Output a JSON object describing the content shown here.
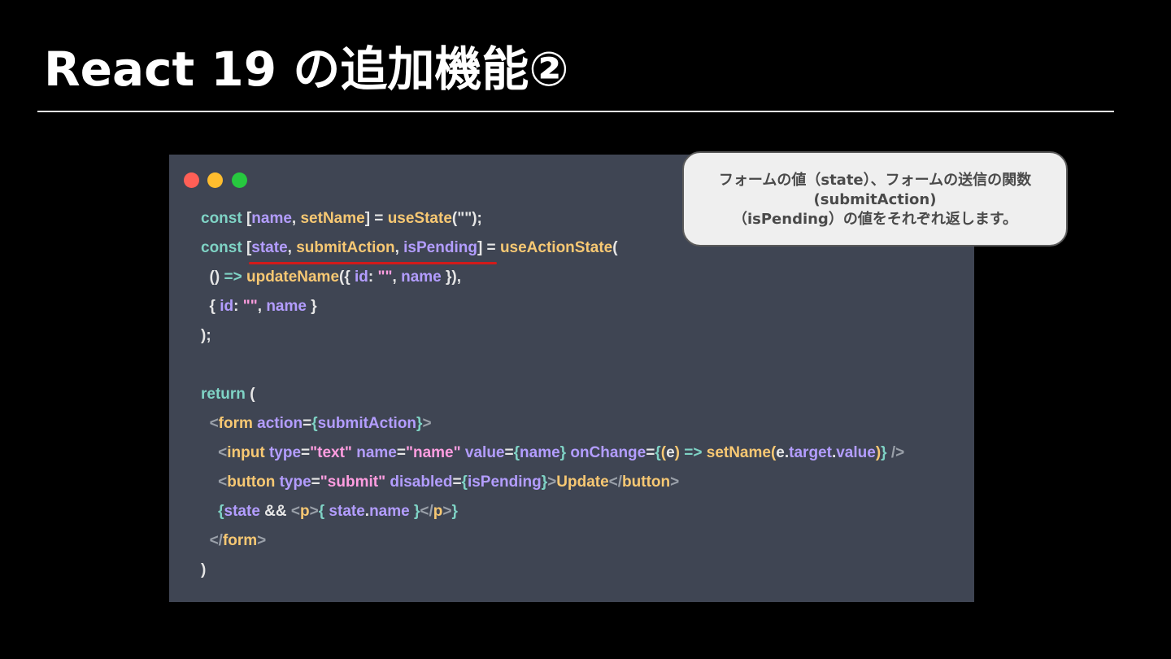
{
  "slide": {
    "title": "React 19 の追加機能②"
  },
  "callout": {
    "lines": [
      "フォームの値（state）、フォームの送信の関数",
      "(submitAction)",
      "（isPending）の値をそれぞれ返します。"
    ]
  },
  "colors": {
    "background": "#000000",
    "code_background": "#3f4553",
    "keyword": "#7fd3c5",
    "variable": "#b39dff",
    "function": "#f7c873",
    "string": "#ff9de0",
    "underline": "#d21a1a",
    "dot_red": "#ff5f56",
    "dot_yellow": "#ffbd2e",
    "dot_green": "#27c93f"
  },
  "code": {
    "lines": [
      [
        {
          "t": "const ",
          "c": "kw"
        },
        {
          "t": "[",
          "c": "pun"
        },
        {
          "t": "name",
          "c": "var"
        },
        {
          "t": ", ",
          "c": "pun"
        },
        {
          "t": "setName",
          "c": "fn"
        },
        {
          "t": "] = ",
          "c": "pun"
        },
        {
          "t": "useState",
          "c": "fn"
        },
        {
          "t": "(\"\");",
          "c": "pun"
        }
      ],
      [
        {
          "t": "const ",
          "c": "kw"
        },
        {
          "t": "[",
          "c": "pun"
        },
        {
          "t": "state",
          "c": "var"
        },
        {
          "t": ", ",
          "c": "pun"
        },
        {
          "t": "submitAction",
          "c": "fn"
        },
        {
          "t": ", ",
          "c": "pun"
        },
        {
          "t": "isPending",
          "c": "var"
        },
        {
          "t": "] = ",
          "c": "pun"
        },
        {
          "t": "useActionState",
          "c": "fn"
        },
        {
          "t": "(",
          "c": "pun"
        }
      ],
      [
        {
          "t": "  () ",
          "c": "pun"
        },
        {
          "t": "=> ",
          "c": "kw"
        },
        {
          "t": "updateName",
          "c": "fn"
        },
        {
          "t": "({ ",
          "c": "pun"
        },
        {
          "t": "id",
          "c": "var"
        },
        {
          "t": ": ",
          "c": "pun"
        },
        {
          "t": "\"\"",
          "c": "str"
        },
        {
          "t": ", ",
          "c": "pun"
        },
        {
          "t": "name",
          "c": "var"
        },
        {
          "t": " }),",
          "c": "pun"
        }
      ],
      [
        {
          "t": "  { ",
          "c": "pun"
        },
        {
          "t": "id",
          "c": "var"
        },
        {
          "t": ": ",
          "c": "pun"
        },
        {
          "t": "\"\"",
          "c": "str"
        },
        {
          "t": ", ",
          "c": "pun"
        },
        {
          "t": "name",
          "c": "var"
        },
        {
          "t": " }",
          "c": "pun"
        }
      ],
      [
        {
          "t": ");",
          "c": "pun"
        }
      ],
      [],
      [
        {
          "t": "return ",
          "c": "kw"
        },
        {
          "t": "(",
          "c": "pun"
        }
      ],
      [
        {
          "t": "  ",
          "c": "pun"
        },
        {
          "t": "<",
          "c": "dim"
        },
        {
          "t": "form ",
          "c": "fn"
        },
        {
          "t": "action",
          "c": "var"
        },
        {
          "t": "=",
          "c": "pun"
        },
        {
          "t": "{",
          "c": "brace"
        },
        {
          "t": "submitAction",
          "c": "var"
        },
        {
          "t": "}",
          "c": "brace"
        },
        {
          "t": ">",
          "c": "dim"
        }
      ],
      [
        {
          "t": "    ",
          "c": "pun"
        },
        {
          "t": "<",
          "c": "dim"
        },
        {
          "t": "input ",
          "c": "fn"
        },
        {
          "t": "type",
          "c": "var"
        },
        {
          "t": "=",
          "c": "pun"
        },
        {
          "t": "\"text\" ",
          "c": "str"
        },
        {
          "t": "name",
          "c": "var"
        },
        {
          "t": "=",
          "c": "pun"
        },
        {
          "t": "\"name\" ",
          "c": "str"
        },
        {
          "t": "value",
          "c": "var"
        },
        {
          "t": "=",
          "c": "pun"
        },
        {
          "t": "{",
          "c": "brace"
        },
        {
          "t": "name",
          "c": "var"
        },
        {
          "t": "} ",
          "c": "brace"
        },
        {
          "t": "onChange",
          "c": "var"
        },
        {
          "t": "=",
          "c": "pun"
        },
        {
          "t": "{",
          "c": "brace"
        },
        {
          "t": "(",
          "c": "fn"
        },
        {
          "t": "e",
          "c": "plain"
        },
        {
          "t": ") ",
          "c": "fn"
        },
        {
          "t": "=> ",
          "c": "kw"
        },
        {
          "t": "setName",
          "c": "fn"
        },
        {
          "t": "(",
          "c": "fn"
        },
        {
          "t": "e",
          "c": "plain"
        },
        {
          "t": ".",
          "c": "pun"
        },
        {
          "t": "target",
          "c": "var"
        },
        {
          "t": ".",
          "c": "pun"
        },
        {
          "t": "value",
          "c": "var"
        },
        {
          "t": ")",
          "c": "fn"
        },
        {
          "t": "} ",
          "c": "brace"
        },
        {
          "t": "/>",
          "c": "dim"
        }
      ],
      [
        {
          "t": "    ",
          "c": "pun"
        },
        {
          "t": "<",
          "c": "dim"
        },
        {
          "t": "button ",
          "c": "fn"
        },
        {
          "t": "type",
          "c": "var"
        },
        {
          "t": "=",
          "c": "pun"
        },
        {
          "t": "\"submit\" ",
          "c": "str"
        },
        {
          "t": "disabled",
          "c": "var"
        },
        {
          "t": "=",
          "c": "pun"
        },
        {
          "t": "{",
          "c": "brace"
        },
        {
          "t": "isPending",
          "c": "var"
        },
        {
          "t": "}",
          "c": "brace"
        },
        {
          "t": ">",
          "c": "dim"
        },
        {
          "t": "Update",
          "c": "fn"
        },
        {
          "t": "</",
          "c": "dim"
        },
        {
          "t": "button",
          "c": "fn"
        },
        {
          "t": ">",
          "c": "dim"
        }
      ],
      [
        {
          "t": "    ",
          "c": "pun"
        },
        {
          "t": "{",
          "c": "brace"
        },
        {
          "t": "state ",
          "c": "var"
        },
        {
          "t": "&& ",
          "c": "pun"
        },
        {
          "t": "<",
          "c": "dim"
        },
        {
          "t": "p",
          "c": "fn"
        },
        {
          "t": ">",
          "c": "dim"
        },
        {
          "t": "{ ",
          "c": "brace"
        },
        {
          "t": "state",
          "c": "var"
        },
        {
          "t": ".",
          "c": "pun"
        },
        {
          "t": "name ",
          "c": "var"
        },
        {
          "t": "}",
          "c": "brace"
        },
        {
          "t": "</",
          "c": "dim"
        },
        {
          "t": "p",
          "c": "fn"
        },
        {
          "t": ">",
          "c": "dim"
        },
        {
          "t": "}",
          "c": "brace"
        }
      ],
      [
        {
          "t": "  ",
          "c": "pun"
        },
        {
          "t": "</",
          "c": "dim"
        },
        {
          "t": "form",
          "c": "fn"
        },
        {
          "t": ">",
          "c": "dim"
        }
      ],
      [
        {
          "t": ")",
          "c": "pun"
        }
      ]
    ]
  }
}
